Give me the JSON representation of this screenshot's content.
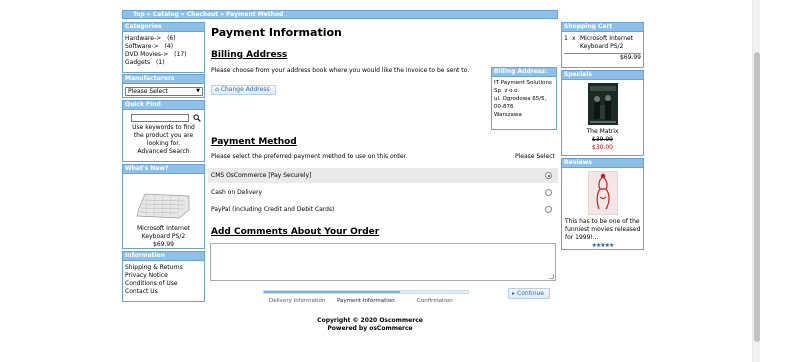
{
  "breadcrumb": [
    "Top",
    "Catalog",
    "Checkout",
    "Payment Method"
  ],
  "breadcrumb_sep": " » ",
  "left": {
    "categories": {
      "title": "Categories",
      "items": [
        {
          "name": "Hardware->",
          "count": "(6)"
        },
        {
          "name": "Software->",
          "count": "(4)"
        },
        {
          "name": "DVD Movies->",
          "count": "(17)"
        },
        {
          "name": "Gadgets",
          "count": "(1)"
        }
      ]
    },
    "manufacturers": {
      "title": "Manufacturers",
      "selected": "Please Select"
    },
    "quick_find": {
      "title": "Quick Find",
      "hint": "Use keywords to find the product you are looking for.",
      "advanced": "Advanced Search"
    },
    "whats_new": {
      "title": "What's New?",
      "product": "Microsoft Internet Keyboard PS/2",
      "price": "$69.99"
    },
    "information": {
      "title": "Information",
      "links": [
        "Shipping & Returns",
        "Privacy Notice",
        "Conditions of Use",
        "Contact Us"
      ]
    }
  },
  "main": {
    "title": "Payment Information",
    "billing": {
      "heading": "Billing Address",
      "text": "Please choose from your address book where you would like the invoice to be sent to.",
      "button": "Change Address",
      "box_title": "Billing Address:",
      "address_lines": [
        "IT Payment Solutions",
        "Sp. z o.o.",
        "ul. Ogrodowa 65/5,",
        "00-876",
        "Warszawa"
      ]
    },
    "payment": {
      "heading": "Payment Method",
      "text": "Please select the preferred payment method to use on this order.",
      "select_label": "Please Select",
      "options": [
        {
          "label": "CMS OsCommerce [Pay Securely]",
          "selected": true
        },
        {
          "label": "Cash on Delivery",
          "selected": false
        },
        {
          "label": "PayPal (including Credit and Debit Cards)",
          "selected": false
        }
      ]
    },
    "comments": {
      "heading": "Add Comments About Your Order"
    },
    "progress": {
      "steps": [
        "Delivery Information",
        "Payment Information",
        "Confirmation"
      ],
      "current_step": 2
    },
    "continue_button": "Continue",
    "footer": [
      "Copyright © 2020 Oscommerce",
      "Powered by osCommerce"
    ]
  },
  "right": {
    "cart": {
      "title": "Shopping Cart",
      "qty": "1",
      "x": "x",
      "product": "Microsoft Internet Keyboard PS/2",
      "total": "$69.99"
    },
    "specials": {
      "title": "Specials",
      "product": "The Matrix",
      "old_price": "$39.99",
      "new_price": "$30.00"
    },
    "reviews": {
      "title": "Reviews",
      "text": "This has to be one of the funniest movies released for 1999!...",
      "stars": "★★★★★"
    }
  },
  "colors": {
    "accent": "#8fc0e8",
    "border": "#6aa2d2",
    "special_price": "#c00000"
  }
}
